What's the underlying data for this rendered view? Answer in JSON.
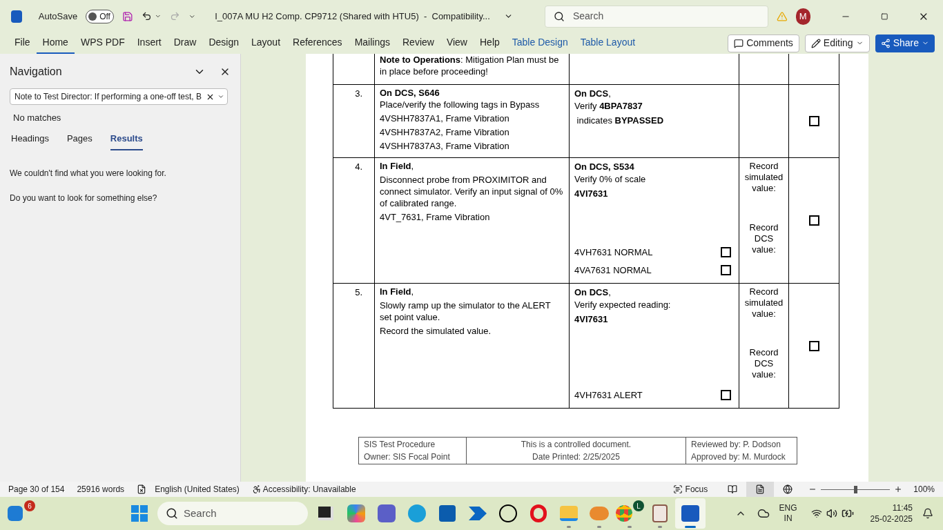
{
  "title_bar": {
    "autosave_label": "AutoSave",
    "autosave": {
      "on": false,
      "label": "Off"
    },
    "redo_disabled": true,
    "document_title": "I_007A MU H2 Comp. CP9712 (Shared with HTU5)  -  Compatibility...",
    "search_placeholder": "Search",
    "avatar": "M"
  },
  "ribbon": {
    "tabs": [
      {
        "label": "File",
        "selected": false,
        "kind": "normal"
      },
      {
        "label": "Home",
        "selected": true,
        "kind": "normal"
      },
      {
        "label": "WPS PDF",
        "selected": false,
        "kind": "normal"
      },
      {
        "label": "Insert",
        "selected": false,
        "kind": "normal"
      },
      {
        "label": "Draw",
        "selected": false,
        "kind": "normal"
      },
      {
        "label": "Design",
        "selected": false,
        "kind": "normal"
      },
      {
        "label": "Layout",
        "selected": false,
        "kind": "normal"
      },
      {
        "label": "References",
        "selected": false,
        "kind": "normal"
      },
      {
        "label": "Mailings",
        "selected": false,
        "kind": "normal"
      },
      {
        "label": "Review",
        "selected": false,
        "kind": "normal"
      },
      {
        "label": "View",
        "selected": false,
        "kind": "normal"
      },
      {
        "label": "Help",
        "selected": false,
        "kind": "normal"
      },
      {
        "label": "Table Design",
        "selected": false,
        "kind": "contextual"
      },
      {
        "label": "Table Layout",
        "selected": false,
        "kind": "contextual"
      }
    ],
    "comments": "Comments",
    "editing": "Editing",
    "share": "Share"
  },
  "navigation": {
    "title": "Navigation",
    "search_value": "Note to Test Director: If performing a one-off test, B",
    "status": "No matches",
    "tabs": [
      {
        "label": "Headings",
        "selected": false
      },
      {
        "label": "Pages",
        "selected": false
      },
      {
        "label": "Results",
        "selected": true
      }
    ],
    "messages": [
      "We couldn't find what you were looking for.",
      "Do you want to look for something else?"
    ]
  },
  "document": {
    "rows": [
      {
        "number": "",
        "step": [
          "**Note to Operations**: Mitigation Plan must be in place before proceeding!"
        ],
        "verify": [],
        "checks": [],
        "record": []
      },
      {
        "number": "3.",
        "step": [
          "**On DCS, S646**",
          "Place/verify the following tags in Bypass",
          "4VSHH7837A1, Frame Vibration",
          "4VSHH7837A2, Frame Vibration",
          "4VSHH7837A3, Frame Vibration"
        ],
        "verify": [
          "**On DCS**,",
          "Verify **4BPA7837**",
          " indicates **BYPASSED**"
        ],
        "checks": [],
        "record": [],
        "signoff": {
          "checked": false
        }
      },
      {
        "number": "4.",
        "step": [
          "**In Field**,",
          "Disconnect probe from PROXIMITOR and connect simulator. Verify an input signal of 0% of calibrated range.",
          "4VT_7631, Frame Vibration"
        ],
        "verify": [
          "**On DCS, S534**",
          "Verify 0% of scale",
          "**4VI7631**"
        ],
        "checks": [
          {
            "label": "4VH7631 NORMAL",
            "checked": false
          },
          {
            "label": "4VA7631 NORMAL",
            "checked": false
          }
        ],
        "record": [
          "Record simulated value:",
          "Record DCS value:"
        ],
        "signoff": {
          "checked": false
        }
      },
      {
        "number": "5.",
        "step": [
          "**In Field**,",
          "Slowly ramp up the simulator to the ALERT set point value.",
          "Record the simulated value."
        ],
        "verify": [
          "**On DCS**,",
          "Verify expected reading:",
          "**4VI7631**"
        ],
        "checks": [
          {
            "label": "4VH7631 ALERT",
            "checked": false
          }
        ],
        "record": [
          "Record simulated value:",
          "Record DCS value:"
        ],
        "signoff": {
          "checked": false
        }
      }
    ],
    "footer": [
      [
        "SIS Test Procedure",
        "Owner: SIS Focal Point"
      ],
      [
        "This is a controlled document.",
        "Date Printed: 2/25/2025"
      ],
      [
        "Reviewed by: P. Dodson",
        "Approved by: M. Murdock"
      ]
    ]
  },
  "status_bar": {
    "page": "Page 30 of 154",
    "words": "25916 words",
    "language": "English (United States)",
    "accessibility": "Accessibility: Unavailable",
    "focus": "Focus",
    "views": [
      {
        "kind": "read",
        "selected": false
      },
      {
        "kind": "print",
        "selected": true
      },
      {
        "kind": "web",
        "selected": false
      }
    ],
    "zoom": {
      "level": 0.5,
      "label": "100%"
    }
  },
  "taskbar": {
    "search_placeholder": "Search",
    "apps": [
      {
        "kind": "mail",
        "badge": "6",
        "running": false,
        "active": false
      },
      {
        "kind": "start",
        "running": false,
        "active": false
      },
      {
        "kind": "search",
        "running": false,
        "active": false
      },
      {
        "kind": "terminal",
        "running": false,
        "active": false
      },
      {
        "kind": "copilot",
        "running": false,
        "active": false
      },
      {
        "kind": "teams",
        "running": false,
        "active": false
      },
      {
        "kind": "edge",
        "running": false,
        "active": false
      },
      {
        "kind": "store",
        "running": false,
        "active": false
      },
      {
        "kind": "automate",
        "running": false,
        "active": false
      },
      {
        "kind": "dell",
        "running": false,
        "active": false
      },
      {
        "kind": "opera",
        "running": false,
        "active": false
      },
      {
        "kind": "files",
        "running": true,
        "active": false
      },
      {
        "kind": "photos",
        "running": true,
        "active": false
      },
      {
        "kind": "chrome",
        "badge": "L",
        "running": true,
        "active": false
      },
      {
        "kind": "contact",
        "running": true,
        "active": false
      },
      {
        "kind": "word",
        "running": true,
        "active": true
      }
    ],
    "language": [
      "ENG",
      "IN"
    ],
    "time": "11:45",
    "date": "25-02-2025"
  }
}
